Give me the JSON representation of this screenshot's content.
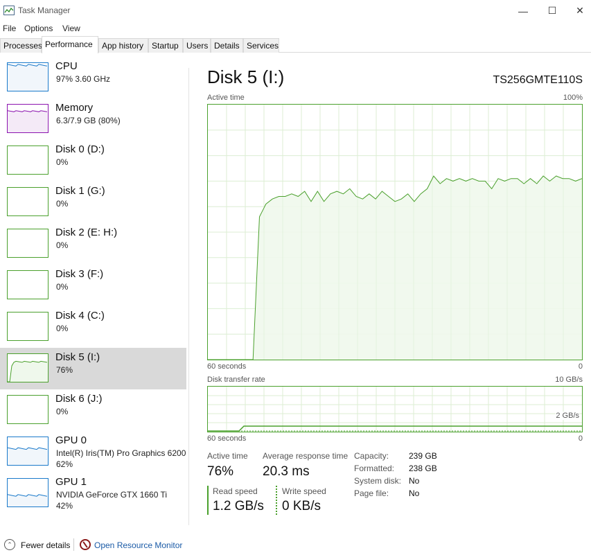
{
  "window": {
    "title": "Task Manager"
  },
  "menu": [
    "File",
    "Options",
    "View"
  ],
  "tabs": [
    "Processes",
    "Performance",
    "App history",
    "Startup",
    "Users",
    "Details",
    "Services"
  ],
  "active_tab": "Performance",
  "sidebar": {
    "items": [
      {
        "name": "CPU",
        "line1": "97%  3.60 GHz",
        "line2": "",
        "color": "#1979ca",
        "fill": "#f1f6fb",
        "level": 0.97
      },
      {
        "name": "Memory",
        "line1": "6.3/7.9 GB (80%)",
        "line2": "",
        "color": "#8b12ae",
        "fill": "#f4eaf7",
        "level": 0.8
      },
      {
        "name": "Disk 0 (D:)",
        "line1": "0%",
        "line2": "",
        "color": "#4aa02c",
        "fill": "#eff8ec",
        "level": 0
      },
      {
        "name": "Disk 1 (G:)",
        "line1": "0%",
        "line2": "",
        "color": "#4aa02c",
        "fill": "#eff8ec",
        "level": 0
      },
      {
        "name": "Disk 2 (E: H:)",
        "line1": "0%",
        "line2": "",
        "color": "#4aa02c",
        "fill": "#eff8ec",
        "level": 0
      },
      {
        "name": "Disk 3 (F:)",
        "line1": "0%",
        "line2": "",
        "color": "#4aa02c",
        "fill": "#eff8ec",
        "level": 0
      },
      {
        "name": "Disk 4 (C:)",
        "line1": "0%",
        "line2": "",
        "color": "#4aa02c",
        "fill": "#eff8ec",
        "level": 0
      },
      {
        "name": "Disk 5 (I:)",
        "line1": "76%",
        "line2": "",
        "color": "#4aa02c",
        "fill": "#eff8ec",
        "level": 0.76,
        "selected": true
      },
      {
        "name": "Disk 6 (J:)",
        "line1": "0%",
        "line2": "",
        "color": "#4aa02c",
        "fill": "#eff8ec",
        "level": 0
      },
      {
        "name": "GPU 0",
        "line1": "Intel(R) Iris(TM) Pro Graphics 6200",
        "line2": "62%",
        "color": "#1979ca",
        "fill": "#f1f6fb",
        "level": 0.62
      },
      {
        "name": "GPU 1",
        "line1": "NVIDIA GeForce GTX 1660 Ti",
        "line2": "42%",
        "color": "#1979ca",
        "fill": "#f1f6fb",
        "level": 0.42
      }
    ]
  },
  "main": {
    "title": "Disk 5 (I:)",
    "model": "TS256GMTE110S",
    "active_chart": {
      "label": "Active time",
      "max_label": "100%",
      "time_label": "60 seconds",
      "min_label": "0"
    },
    "transfer_chart": {
      "label": "Disk transfer rate",
      "max_label": "10 GB/s",
      "mid_label": "2 GB/s",
      "time_label": "60 seconds",
      "min_label": "0"
    },
    "stats": {
      "active_time_label": "Active time",
      "active_time": "76%",
      "avg_response_label": "Average response time",
      "avg_response": "20.3 ms",
      "read_label": "Read speed",
      "read": "1.2 GB/s",
      "write_label": "Write speed",
      "write": "0 KB/s"
    },
    "props": [
      {
        "key": "Capacity:",
        "value": "239 GB"
      },
      {
        "key": "Formatted:",
        "value": "238 GB"
      },
      {
        "key": "System disk:",
        "value": "No"
      },
      {
        "key": "Page file:",
        "value": "No"
      }
    ]
  },
  "footer": {
    "fewer_details": "Fewer details",
    "resource_monitor": "Open Resource Monitor"
  },
  "chart_data": {
    "type": "area",
    "x_label": "60 seconds",
    "ylim": [
      0,
      100
    ],
    "active_time_percent": [
      0,
      0,
      0,
      0,
      0,
      0,
      0,
      0,
      56,
      61,
      63,
      64,
      64,
      65,
      64,
      66,
      62,
      66,
      62,
      65,
      66,
      65,
      67,
      64,
      63,
      65,
      63,
      66,
      64,
      62,
      63,
      65,
      62,
      65,
      67,
      72,
      69,
      71,
      70,
      71,
      70,
      71,
      70,
      70,
      67,
      71,
      70,
      71,
      71,
      69,
      71,
      69,
      72,
      70,
      72,
      71,
      71,
      70,
      71
    ]
  }
}
